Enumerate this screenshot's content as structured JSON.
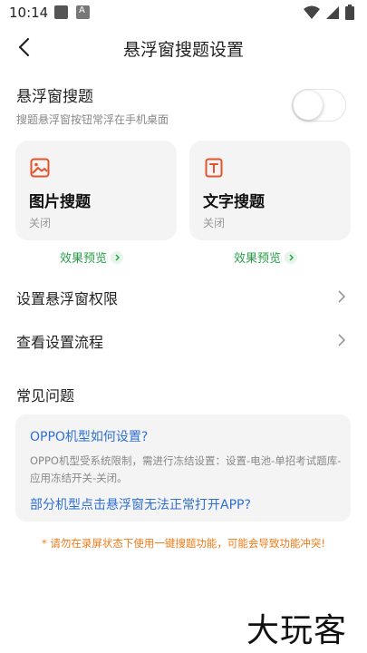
{
  "status_bar": {
    "time": "10:14"
  },
  "header": {
    "title": "悬浮窗搜题设置"
  },
  "float_search": {
    "title": "悬浮窗搜题",
    "subtitle": "搜题悬浮窗按钮常浮在手机桌面",
    "enabled": false
  },
  "cards": [
    {
      "title": "图片搜题",
      "status": "关闭",
      "preview": "效果预览",
      "icon": "image-icon"
    },
    {
      "title": "文字搜题",
      "status": "关闭",
      "preview": "效果预览",
      "icon": "text-icon"
    }
  ],
  "rows": [
    {
      "label": "设置悬浮窗权限"
    },
    {
      "label": "查看设置流程"
    }
  ],
  "faq": {
    "heading": "常见问题",
    "q1": "OPPO机型如何设置?",
    "a1": "OPPO机型受系统限制，需进行冻结设置：设置-电池-单招考试题库-应用冻结开关-关闭。",
    "q2": "部分机型点击悬浮窗无法正常打开APP?"
  },
  "warning": "* 请勿在录屏状态下使用一键搜题功能，可能会导致功能冲突!",
  "watermark": "大玩客",
  "colors": {
    "green": "#2aa04a",
    "blue": "#2e6fd6",
    "orange": "#f07a18"
  }
}
